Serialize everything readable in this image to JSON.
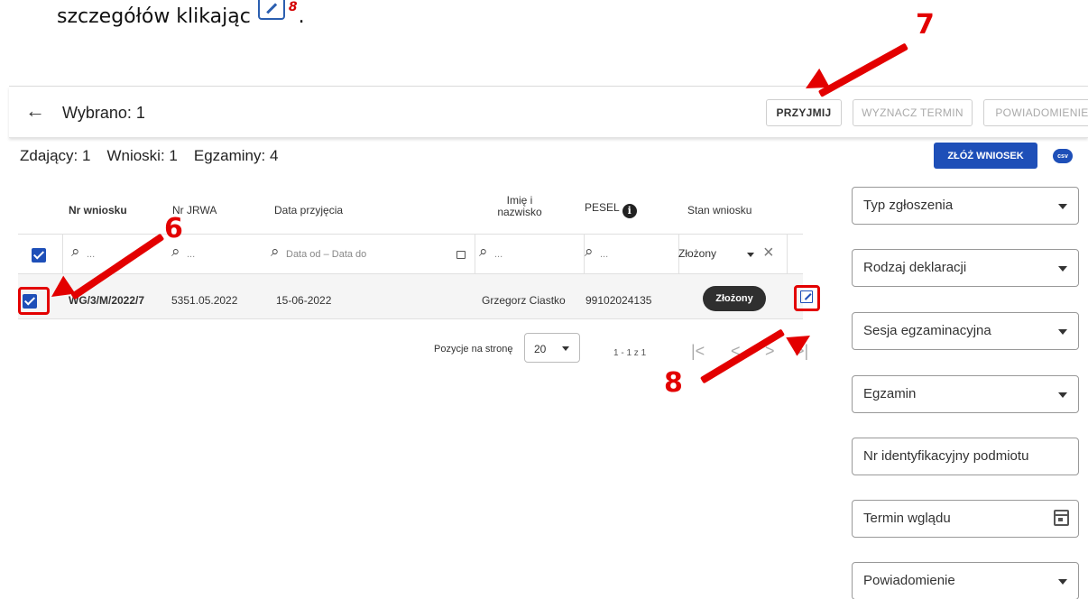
{
  "doc": {
    "text": "szczegółów klikając",
    "superscript": "8",
    "trailing": "."
  },
  "topbar": {
    "title": "Wybrano: 1",
    "accept_label": "PRZYJMIJ",
    "term_label": "WYZNACZ TERMIN",
    "notify_label": "POWIADOMIENIE"
  },
  "counts": {
    "applicants": "Zdający: 1",
    "applications": "Wnioski: 1",
    "exams": "Egzaminy: 4"
  },
  "actions": {
    "submit_label": "ZŁÓŻ WNIOSEK",
    "csv_label": "csv"
  },
  "table": {
    "headers": {
      "nr": "Nr wniosku",
      "jrwa": "Nr JRWA",
      "date": "Data przyjęcia",
      "name": "Imię i nazwisko",
      "pesel": "PESEL",
      "status": "Stan wniosku"
    },
    "filters": {
      "nr_placeholder": "...",
      "jrwa_placeholder": "...",
      "date_placeholder": "Data od – Data do",
      "name_placeholder": "...",
      "pesel_placeholder": "...",
      "status_value": "Złożony"
    },
    "row": {
      "nr": "WG/3/M/2022/7",
      "jrwa": "5351.05.2022",
      "date": "15-06-2022",
      "name": "Grzegorz Ciastko",
      "pesel": "99102024135",
      "status": "Złożony"
    }
  },
  "pagination": {
    "per_page_label": "Pozycje na stronę",
    "per_page_value": "20",
    "range": "1 - 1 z 1"
  },
  "annotations": {
    "step6": "6",
    "step7": "7",
    "step8": "8"
  },
  "sidebar": {
    "filters": [
      {
        "label": "Typ zgłoszenia"
      },
      {
        "label": "Rodzaj deklaracji"
      },
      {
        "label": "Sesja egzaminacyjna"
      },
      {
        "label": "Egzamin"
      },
      {
        "label": "Nr identyfikacyjny podmiotu"
      },
      {
        "label": "Termin wglądu"
      },
      {
        "label": "Powiadomienie"
      }
    ]
  },
  "colors": {
    "accent": "#1e4fb8",
    "annotation_red": "#e30000",
    "badge_dark": "#2f2f2f"
  }
}
